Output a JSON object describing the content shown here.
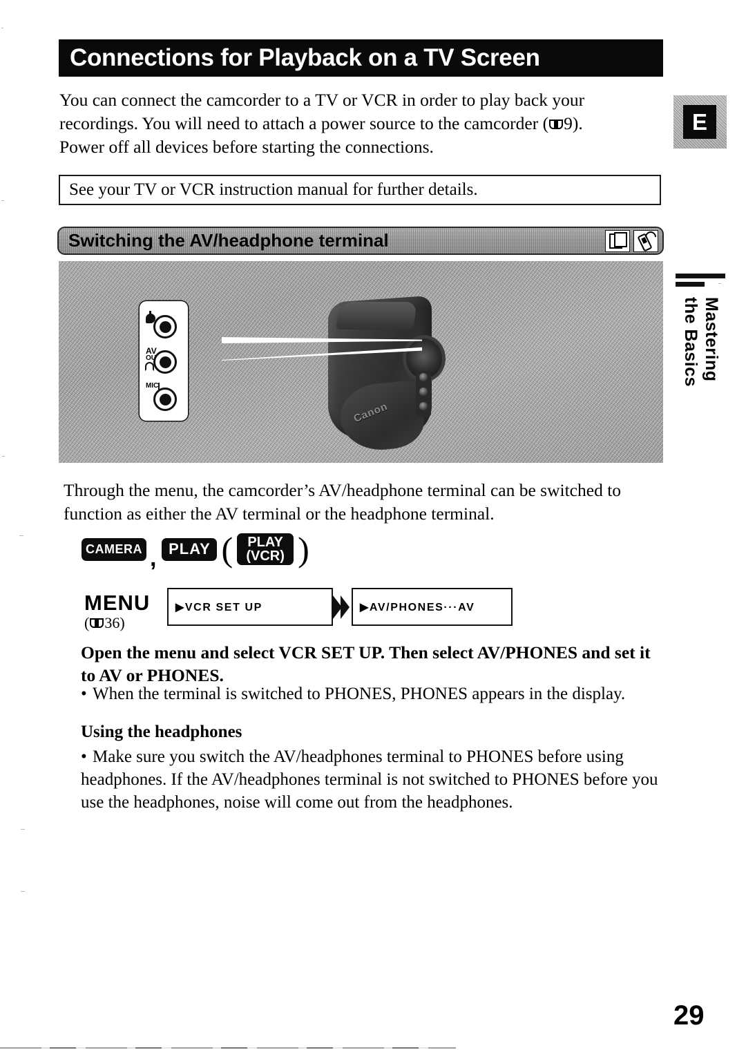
{
  "document": {
    "page_number": "29",
    "language_badge": "E",
    "side_tab": "Mastering\nthe Basics"
  },
  "title": "Connections for Playback on a TV Screen",
  "intro": {
    "line1": "You can connect the camcorder to a TV or VCR in order to play back your",
    "line2_a": "recordings. You will need to attach a power source to the camcorder (",
    "line2_ref": "9).",
    "line3": "Power off all devices before starting the connections."
  },
  "note_box": {
    "text": "See your TV or VCR instruction manual for further details."
  },
  "section": {
    "header": "Switching the AV/headphone terminal",
    "icons": [
      "card-icon",
      "remote-control-icon"
    ]
  },
  "figure": {
    "callout_labels": {
      "dv_symbol": "dv-terminal-icon",
      "av": "AV",
      "out": "OUT",
      "headphone_symbol": "headphone-icon",
      "mic": "MIC"
    },
    "brand": "Canon"
  },
  "paragraph2": {
    "line1": "Through the menu, the camcorder’s AV/headphone terminal can be switched to",
    "line2": "function as either the AV terminal or the headphone terminal."
  },
  "modes": {
    "camera": "CAMERA",
    "separator": ",",
    "play": "PLAY",
    "paren_open": "(",
    "play_vcr_line1": "PLAY",
    "play_vcr_line2": "(VCR)",
    "paren_close": ")"
  },
  "menu": {
    "label": "MENU",
    "reference": "36)",
    "reference_open": "(",
    "step1": "▶VCR SET UP",
    "step2": "▶AV/PHONES···AV"
  },
  "instruction": {
    "bold_line1": "Open the menu and select VCR SET UP. Then select AV/PHONES and set it",
    "bold_line2": "to AV or PHONES.",
    "bullet1": "When the terminal is switched to PHONES, PHONES appears in the display."
  },
  "headphones_section": {
    "heading": "Using the headphones",
    "bullet_line1": "Make sure you switch the AV/headphones terminal to PHONES before using",
    "bullet_line2": "headphones. If the AV/headphones terminal is not switched to PHONES before",
    "bullet_line3": "you use the headphones, noise will come out from the headphones."
  },
  "colors": {
    "title_bar": "#0a0a0a",
    "section_header": "#a8a8a8",
    "text": "#000000",
    "paper": "#ffffff"
  }
}
